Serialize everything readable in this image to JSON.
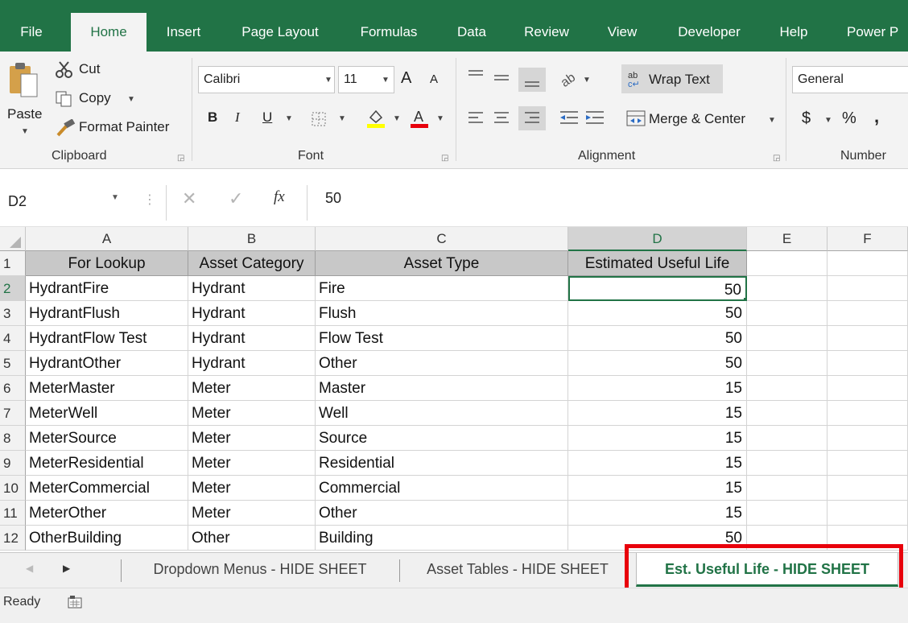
{
  "ribbon_tabs": [
    "File",
    "Home",
    "Insert",
    "Page Layout",
    "Formulas",
    "Data",
    "Review",
    "View",
    "Developer",
    "Help",
    "Power P"
  ],
  "clipboard": {
    "paste": "Paste",
    "cut": "Cut",
    "copy": "Copy",
    "format_painter": "Format Painter",
    "label": "Clipboard"
  },
  "font": {
    "name": "Calibri",
    "size": "11",
    "bold": "B",
    "italic": "I",
    "underline": "U",
    "grow": "A",
    "shrink": "A",
    "label": "Font"
  },
  "alignment": {
    "wrap_text": "Wrap Text",
    "merge_center": "Merge & Center",
    "label": "Alignment"
  },
  "number": {
    "format": "General",
    "currency": "$",
    "percent": "%",
    "comma": ",",
    "label": "Number"
  },
  "formula_bar": {
    "name_box": "D2",
    "fx": "fx",
    "value": "50"
  },
  "columns": [
    "A",
    "B",
    "C",
    "D",
    "E",
    "F"
  ],
  "header_row": [
    "For Lookup",
    "Asset Category",
    "Asset Type",
    "Estimated Useful Life"
  ],
  "row_numbers": [
    "1",
    "2",
    "3",
    "4",
    "5",
    "6",
    "7",
    "8",
    "9",
    "10",
    "11",
    "12"
  ],
  "rows": [
    [
      "HydrantFire",
      "Hydrant",
      "Fire",
      "50"
    ],
    [
      "HydrantFlush",
      "Hydrant",
      "Flush",
      "50"
    ],
    [
      "HydrantFlow Test",
      "Hydrant",
      "Flow Test",
      "50"
    ],
    [
      "HydrantOther",
      "Hydrant",
      "Other",
      "50"
    ],
    [
      "MeterMaster",
      "Meter",
      "Master",
      "15"
    ],
    [
      "MeterWell",
      "Meter",
      "Well",
      "15"
    ],
    [
      "MeterSource",
      "Meter",
      "Source",
      "15"
    ],
    [
      "MeterResidential",
      "Meter",
      "Residential",
      "15"
    ],
    [
      "MeterCommercial",
      "Meter",
      "Commercial",
      "15"
    ],
    [
      "MeterOther",
      "Meter",
      "Other",
      "15"
    ],
    [
      "OtherBuilding",
      "Other",
      "Building",
      "50"
    ]
  ],
  "sheet_tabs": [
    "Dropdown Menus - HIDE SHEET",
    "Asset Tables - HIDE SHEET",
    "Est. Useful Life - HIDE SHEET"
  ],
  "status": {
    "ready": "Ready"
  },
  "colors": {
    "accent": "#217346",
    "highlight": "#e8000b"
  }
}
